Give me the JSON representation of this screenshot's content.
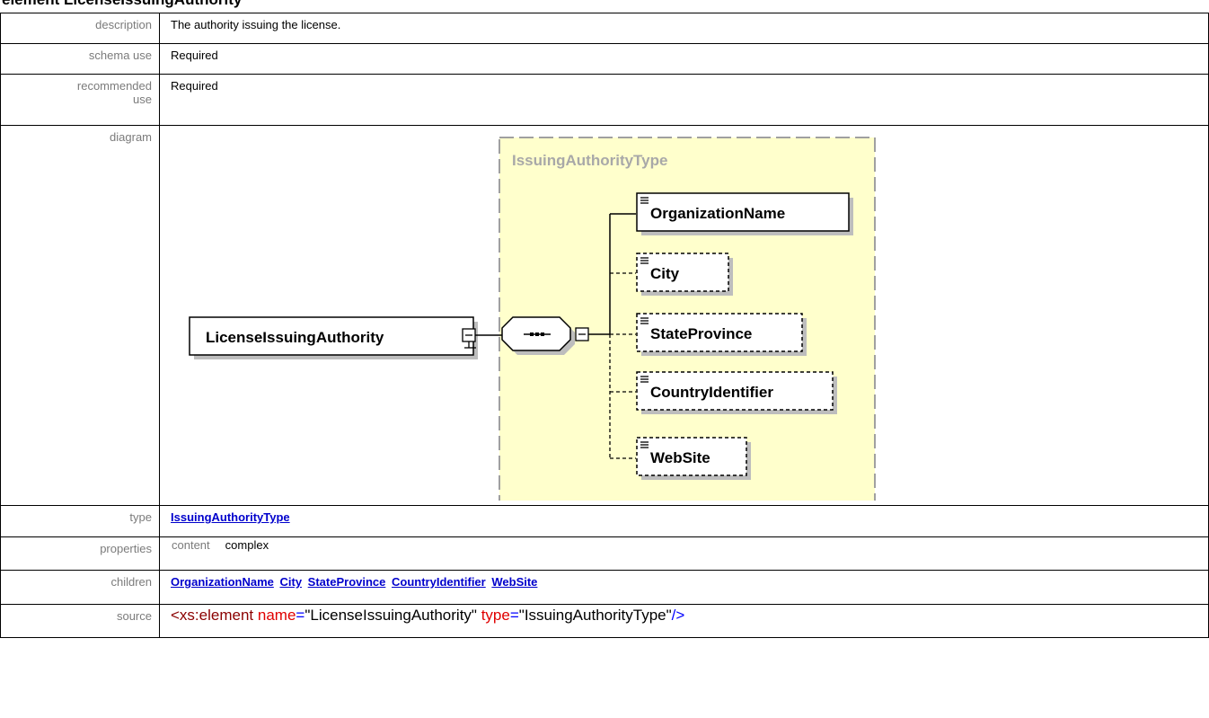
{
  "heading": "element LicenseIssuingAuthority",
  "rows": {
    "description": {
      "label": "description",
      "value": "The authority issuing the license."
    },
    "schema_use": {
      "label": "schema use",
      "value": "Required"
    },
    "recommended_use": {
      "label_line1": "recommended",
      "label_line2": "use",
      "value": "Required"
    },
    "diagram": {
      "label": "diagram",
      "type_box_title": "IssuingAuthorityType",
      "root_element": "LicenseIssuingAuthority",
      "children": [
        "OrganizationName",
        "City",
        "StateProvince",
        "CountryIdentifier",
        "WebSite"
      ]
    },
    "type": {
      "label": "type",
      "link": "IssuingAuthorityType"
    },
    "properties": {
      "label": "properties",
      "key": "content",
      "value": "complex"
    },
    "children": {
      "label": "children",
      "links": [
        "OrganizationName",
        "City",
        "StateProvince",
        "CountryIdentifier",
        "WebSite"
      ]
    },
    "source": {
      "label": "source",
      "tag_open": "<xs:element",
      "attr1_name": "name",
      "attr1_value": "\"LicenseIssuingAuthority\"",
      "attr2_name": "type",
      "attr2_value": "\"IssuingAuthorityType\"",
      "tag_close": "/>",
      "eq": "="
    }
  },
  "colors": {
    "type_box_fill": "#ffffcc",
    "type_box_border": "#a0a0a0",
    "type_box_title": "#a8a8a8",
    "link": "#0000cc"
  }
}
